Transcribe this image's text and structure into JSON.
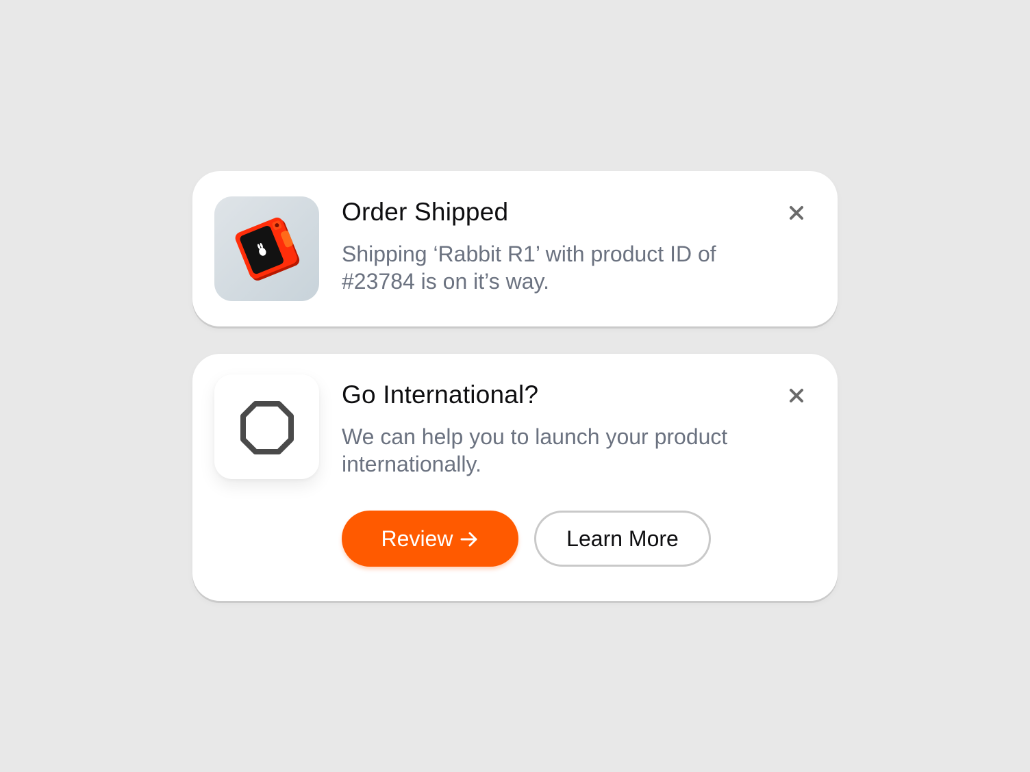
{
  "colors": {
    "background": "#e8e8e8",
    "card": "#ffffff",
    "title": "#0e0e10",
    "body": "#6b7280",
    "accent": "#ff5a00",
    "close": "#6b6b6b"
  },
  "notifications": [
    {
      "title": "Order Shipped",
      "body": "Shipping ‘Rabbit R1’ with product ID of #23784 is on it’s way.",
      "image": "rabbit-r1-device",
      "close_icon": "close-icon"
    },
    {
      "title": "Go International?",
      "body": "We can help you to launch your product internationally.",
      "image": "octagon-icon",
      "close_icon": "close-icon",
      "actions": {
        "primary": {
          "label": "Review",
          "icon": "arrow-right-icon"
        },
        "secondary": {
          "label": "Learn More"
        }
      }
    }
  ]
}
